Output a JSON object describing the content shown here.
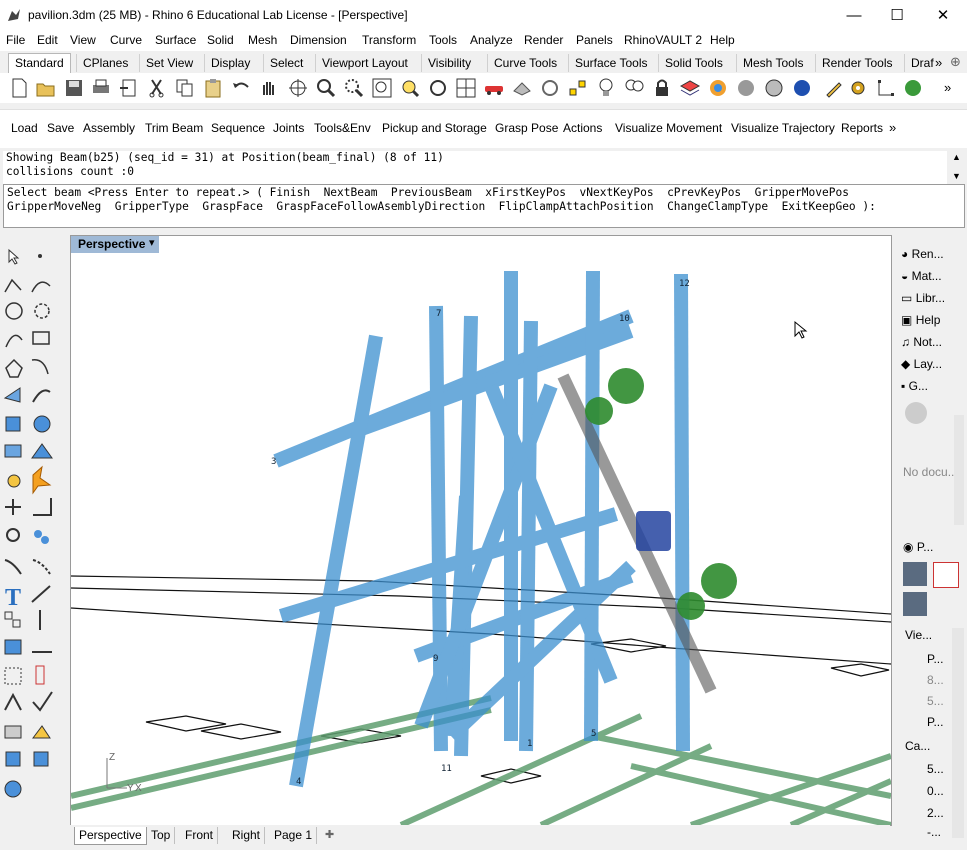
{
  "window": {
    "title": "pavilion.3dm (25 MB) - Rhino 6 Educational Lab License - [Perspective]",
    "minimize": "—",
    "maximize": "☐",
    "close": "✕"
  },
  "menu": [
    "File",
    "Edit",
    "View",
    "Curve",
    "Surface",
    "Solid",
    "Mesh",
    "Dimension",
    "Transform",
    "Tools",
    "Analyze",
    "Render",
    "Panels",
    "RhinoVAULT 2",
    "Help"
  ],
  "tabs": [
    "Standard",
    "CPlanes",
    "Set View",
    "Display",
    "Select",
    "Viewport Layout",
    "Visibility",
    "Curve Tools",
    "Surface Tools",
    "Solid Tools",
    "Mesh Tools",
    "Render Tools",
    "Draf"
  ],
  "tabs_overflow": "»",
  "tabs_add": "⊕",
  "plugin_toolbar": [
    "Load",
    "Save",
    "Assembly",
    "Trim Beam",
    "Sequence",
    "Joints",
    "Tools&Env",
    "Pickup and Storage",
    "Grasp Pose",
    "Actions",
    "Visualize Movement",
    "Visualize Trajectory",
    "Reports"
  ],
  "plugin_overflow": "»",
  "command_history": [
    "Showing Beam(b25) (seq_id = 31) at Position(beam_final) (8 of 11)",
    "collisions count :0"
  ],
  "command_prompt": [
    "Select beam <Press Enter to repeat.> ( Finish  NextBeam  PreviousBeam  xFirstKeyPos  vNextKeyPos  cPrevKeyPos  GripperMovePos",
    "GripperMoveNeg  GripperType  GraspFace  GraspFaceFollowAsemblyDirection  FlipClampAttachPosition  ChangeClampType  ExitKeepGeo ):"
  ],
  "viewport": {
    "label": "Perspective",
    "dropdown": "▾",
    "axis_z": "Z",
    "axis_x": "X",
    "axis_y": "Y",
    "beam_labels": [
      "3",
      "7",
      "9",
      "4",
      "11",
      "12",
      "10",
      "5",
      "1"
    ]
  },
  "bottom_tabs": [
    "Perspective",
    "Top",
    "Front",
    "Right",
    "Page 1"
  ],
  "bottom_tab_add": "✚",
  "right_panel": {
    "tabs": [
      "Ren...",
      "Mat...",
      "Libr...",
      "Help",
      "Not...",
      "Lay...",
      "G..."
    ],
    "no_doc": "No docu..."
  },
  "properties_panel": {
    "title": "P...",
    "view_section": "Vie...",
    "view_rows": [
      "P...",
      "8...",
      "5...",
      "P..."
    ],
    "camera_section": "Ca...",
    "camera_rows": [
      "5...",
      "0...",
      "2...",
      "-..."
    ]
  },
  "colors": {
    "beam_blue": "#5aa9e0",
    "gripper_green": "#2e8b2e",
    "ground_green": "#5f9e6f",
    "viewport_label_bg": "#9fb9d6"
  }
}
